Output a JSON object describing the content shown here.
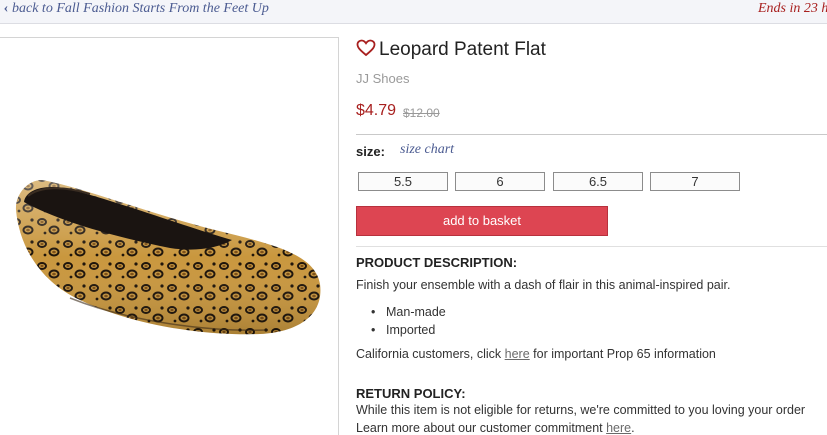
{
  "topbar": {
    "back_label": "back to Fall Fashion Starts From the Feet Up",
    "ends_label": "Ends in 23 h"
  },
  "product": {
    "title": "Leopard Patent Flat",
    "brand": "JJ Shoes",
    "price": "$4.79",
    "original_price": "$12.00"
  },
  "size": {
    "label": "size:",
    "chart_link": "size chart",
    "options": [
      "5.5",
      "6",
      "6.5",
      "7"
    ]
  },
  "cart": {
    "add_label": "add to basket"
  },
  "description": {
    "heading": "PRODUCT DESCRIPTION:",
    "text": "Finish your ensemble with a dash of flair in this animal-inspired pair.",
    "bullets": [
      "Man-made",
      "Imported"
    ],
    "prop65_prefix": "California customers, click ",
    "prop65_link": "here",
    "prop65_suffix": " for important Prop 65 information"
  },
  "return_policy": {
    "heading": "RETURN POLICY:",
    "text": "While this item is not eligible for returns, we're committed to you loving your order",
    "commitment_prefix": "Learn more about our customer commitment ",
    "commitment_link": "here",
    "commitment_suffix": "."
  },
  "colors": {
    "accent_red": "#a8201f",
    "button_red": "#dd4552",
    "link_blue": "#4b5b91"
  }
}
